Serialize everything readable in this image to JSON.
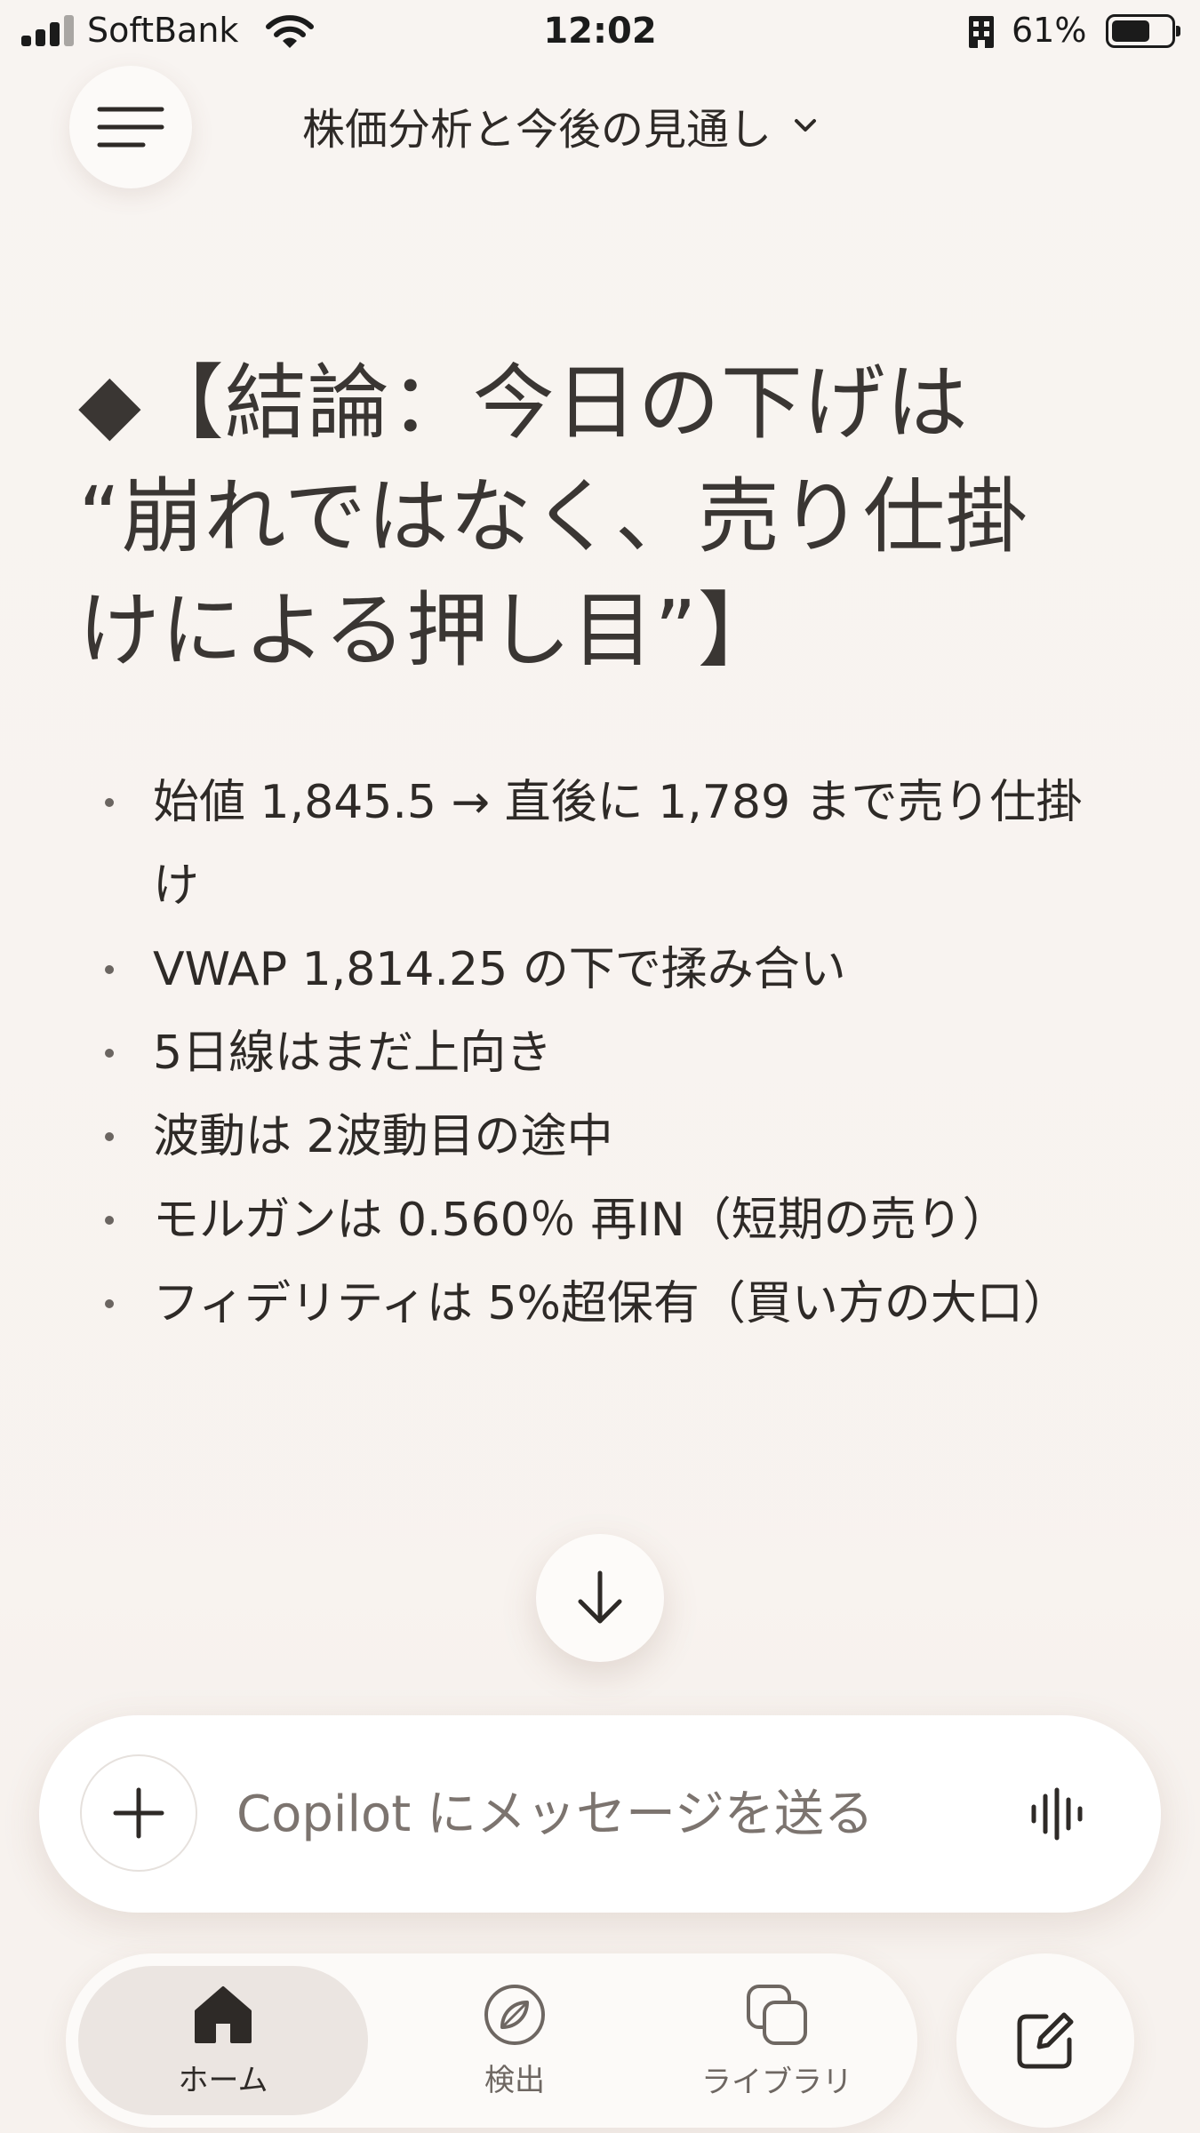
{
  "status_bar": {
    "carrier": "SoftBank",
    "time": "12:02",
    "battery_percent": "61%",
    "battery_level": 0.61,
    "icons": [
      "signal-icon",
      "wifi-icon",
      "building-icon",
      "battery-icon"
    ]
  },
  "header": {
    "menu_icon": "hamburger-icon",
    "chat_title": "株価分析と今後の見通し",
    "title_icon": "chevron-down-icon"
  },
  "message": {
    "heading_line1": "◆【結論：今日の下げは",
    "heading_line2": "“崩れではなく、売り仕掛",
    "heading_line3": "けによる押し目”】",
    "bullets": [
      "始値 1,845.5 → 直後に 1,789 まで売り仕掛け",
      "VWAP 1,814.25 の下で揉み合い",
      "5日線はまだ上向き",
      "波動は 2波動目の途中",
      "モルガンは 0.560％ 再IN（短期の売り）",
      "フィデリティは 5%超保有（買い方の大口）"
    ]
  },
  "scroll_button_icon": "arrow-down-icon",
  "composer": {
    "placeholder": "Copilot にメッセージを送る",
    "plus_icon": "plus-icon",
    "voice_icon": "voice-waveform-icon"
  },
  "bottom_nav": {
    "items": [
      {
        "label": "ホーム",
        "icon": "home-icon"
      },
      {
        "label": "検出",
        "icon": "compass-icon"
      },
      {
        "label": "ライブラリ",
        "icon": "library-icon"
      }
    ],
    "new_chat_icon": "compose-icon"
  },
  "colors": {
    "background": "#f8f4f1",
    "text": "#2e2a27",
    "active_nav": "#ebe5e1"
  }
}
